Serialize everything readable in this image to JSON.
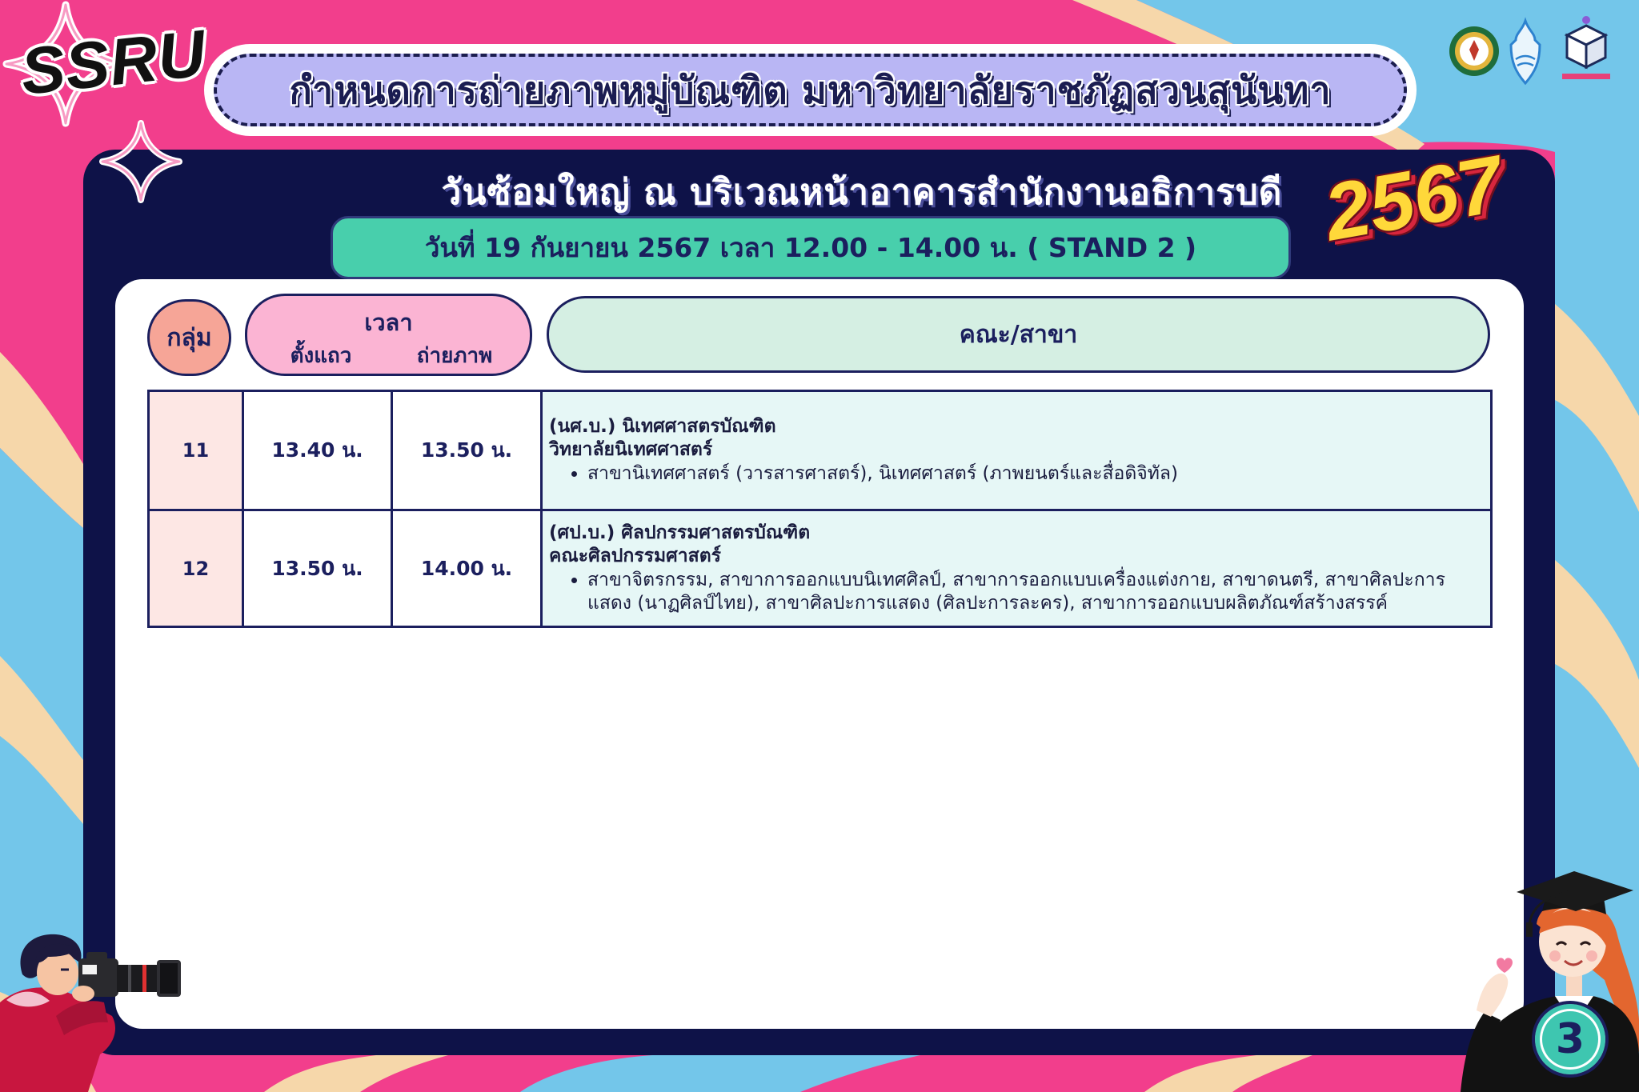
{
  "brand": {
    "logo_text": "SSRU"
  },
  "header": {
    "title": "กำหนดการถ่ายภาพหมู่บัณฑิต มหาวิทยาลัยราชภัฏสวนสุนันทา"
  },
  "event": {
    "subtitle": "วันซ้อมใหญ่ ณ บริเวณหน้าอาคารสำนักงานอธิการบดี",
    "schedule": "วันที่ 19 กันยายน 2567 เวลา 12.00 - 14.00 น. ( STAND 2 )",
    "year": "2567"
  },
  "table": {
    "headers": {
      "group": "กลุ่ม",
      "time": "เวลา",
      "queue": "ตั้งแถว",
      "photo": "ถ่ายภาพ",
      "faculty": "คณะ/สาขา"
    },
    "rows": [
      {
        "group": "11",
        "queue_time": "13.40 น.",
        "photo_time": "13.50 น.",
        "degree": "(นศ.บ.) นิเทศศาสตรบัณฑิต",
        "faculty": "วิทยาลัยนิเทศศาสตร์",
        "majors": [
          "สาขานิเทศศาสตร์ (วารสารศาสตร์), นิเทศศาสตร์ (ภาพยนตร์และสื่อดิจิทัล)"
        ]
      },
      {
        "group": "12",
        "queue_time": "13.50 น.",
        "photo_time": "14.00 น.",
        "degree": "(ศป.บ.) ศิลปกรรมศาสตรบัณฑิต",
        "faculty": "คณะศิลปกรรมศาสตร์",
        "majors": [
          "สาขาจิตรกรรม, สาขาการออกแบบนิเทศศิลป์, สาขาการออกแบบเครื่องแต่งกาย, สาขาดนตรี, สาขาศิลปะการแสดง (นาฏศิลป์ไทย), สาขาศิลปะการแสดง (ศิลปะการละคร), สาขาการออกแบบผลิตภัณฑ์สร้างสรรค์"
        ]
      }
    ]
  },
  "page_badge": "3",
  "logos": [
    "university-seal-logo",
    "emblem-logo",
    "cube-logo"
  ],
  "colors": {
    "background": "#f23e8c",
    "panel": "#0e1248",
    "banner": "#b9b6f4",
    "schedule_bar": "#48cfac",
    "year": "#ffd83a",
    "group_header": "#f6a597",
    "time_header": "#fbb4d3",
    "faculty_header": "#d5efe3",
    "text_dark": "#1b1f5e"
  }
}
